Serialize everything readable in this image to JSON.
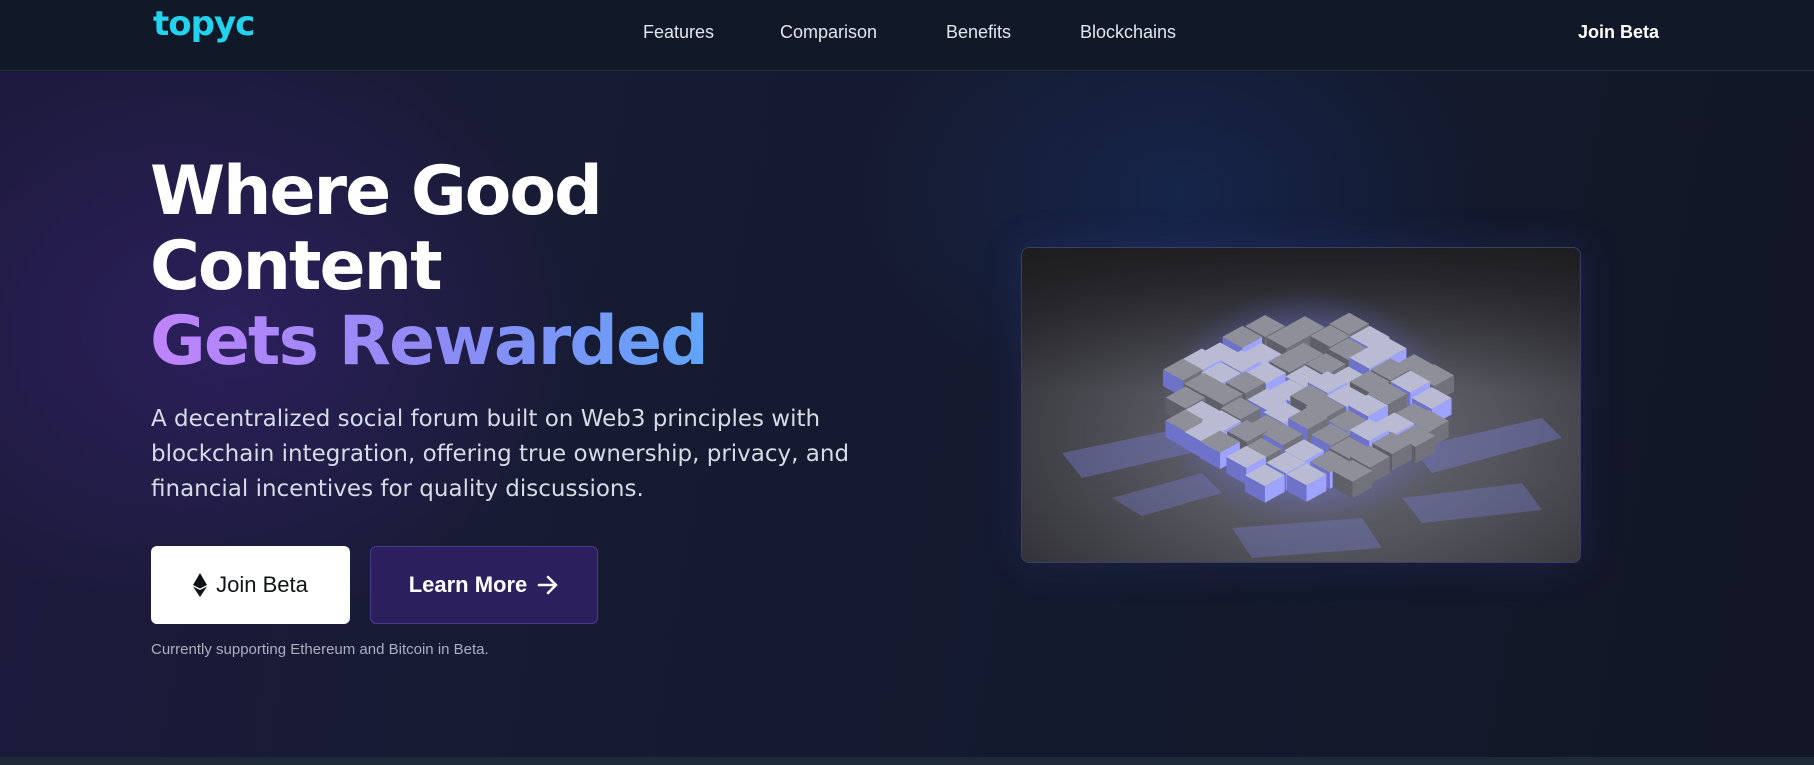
{
  "brand": {
    "logo": "topyc",
    "accent_color": "#22d3ee"
  },
  "nav": {
    "links": [
      {
        "label": "Features"
      },
      {
        "label": "Comparison"
      },
      {
        "label": "Benefits"
      },
      {
        "label": "Blockchains"
      }
    ],
    "cta_label": "Join Beta"
  },
  "hero": {
    "headline_line1": "Where Good",
    "headline_line2": "Content",
    "headline_accent": "Gets Rewarded",
    "subtext": "A decentralized social forum built on Web3 principles with blockchain integration, offering true ownership, privacy, and financial incentives for quality discussions.",
    "primary_button": {
      "label": "Join Beta",
      "icon": "ethereum-icon"
    },
    "secondary_button": {
      "label": "Learn More",
      "icon": "arrow-right-icon"
    },
    "note": "Currently supporting Ethereum and Bitcoin in Beta.",
    "image": {
      "subject": "glowing-cube-image"
    }
  },
  "colors": {
    "background": "#121626",
    "nav_background": "#111827",
    "gradient_start": "#c084fc",
    "gradient_end": "#60a5fa",
    "secondary_button_bg": "#2c1f5e"
  }
}
